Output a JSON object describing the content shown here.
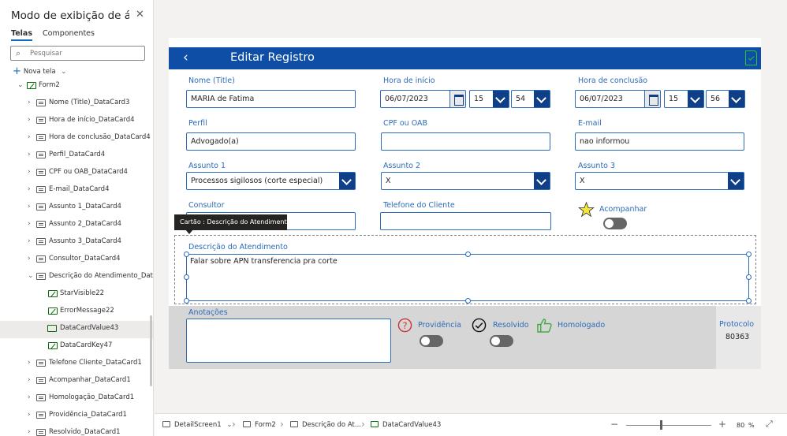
{
  "panel": {
    "title": "Modo de exibição de ár...",
    "tab_active": "Telas",
    "tab_other": "Componentes",
    "search_placeholder": "Pesquisar",
    "new_screen": "Nova tela",
    "tree": [
      "Form2",
      "Nome (Title)_DataCard3",
      "Hora de início_DataCard4",
      "Hora de conclusão_DataCard4",
      "Perfil_DataCard4",
      "CPF ou OAB_DataCard4",
      "E-mail_DataCard4",
      "Assunto 1_DataCard4",
      "Assunto 2_DataCard4",
      "Assunto 3_DataCard4",
      "Consultor_DataCard4",
      "Descrição do Atendimento_DataCard",
      "StarVisible22",
      "ErrorMessage22",
      "DataCardValue43",
      "DataCardKey47",
      "Telefone Cliente_DataCard1",
      "Acompanhar_DataCard1",
      "Homologação_DataCard1",
      "Providência_DataCard1",
      "Resolvido_DataCard1"
    ]
  },
  "form": {
    "header_title": "Editar Registro",
    "nome_label": "Nome (Title)",
    "nome_value": "MARIA de Fatima",
    "inicio_label": "Hora de início",
    "inicio_date": "06/07/2023",
    "inicio_hour": "15",
    "inicio_min": "54",
    "conclusao_label": "Hora de conclusão",
    "conclusao_date": "06/07/2023",
    "conclusao_hour": "15",
    "conclusao_min": "56",
    "perfil_label": "Perfil",
    "perfil_value": "Advogado(a)",
    "cpf_label": "CPF ou OAB",
    "cpf_value": "",
    "email_label": "E-mail",
    "email_value": "nao informou",
    "assunto1_label": "Assunto 1",
    "assunto1_value": "Processos sigilosos (corte especial)",
    "assunto2_label": "Assunto 2",
    "assunto2_value": "X",
    "assunto3_label": "Assunto 3",
    "assunto3_value": "X",
    "consultor_label": "Consultor",
    "telefone_label": "Telefone do Cliente",
    "acompanhar_label": "Acompanhar",
    "tooltip": "Cartão : Descrição do Atendimento",
    "descricao_label": "Descrição do Atendimento",
    "descricao_value": "Falar sobre APN transferencia pra corte",
    "anotacoes_label": "Anotações",
    "providencia_label": "Providência",
    "resolvido_label": "Resolvido",
    "homologado_label": "Homologado",
    "protocolo_label": "Protocolo",
    "protocolo_value": "80363"
  },
  "bottom": {
    "screen": "DetailScreen1",
    "form": "Form2",
    "card": "Descrição do At...",
    "control": "DataCardValue43",
    "zoom": "80",
    "zoom_unit": "%"
  },
  "colors": {
    "header": "#0f4ea6",
    "accent": "#2c6bb8",
    "dropdown": "#0f3f86"
  }
}
